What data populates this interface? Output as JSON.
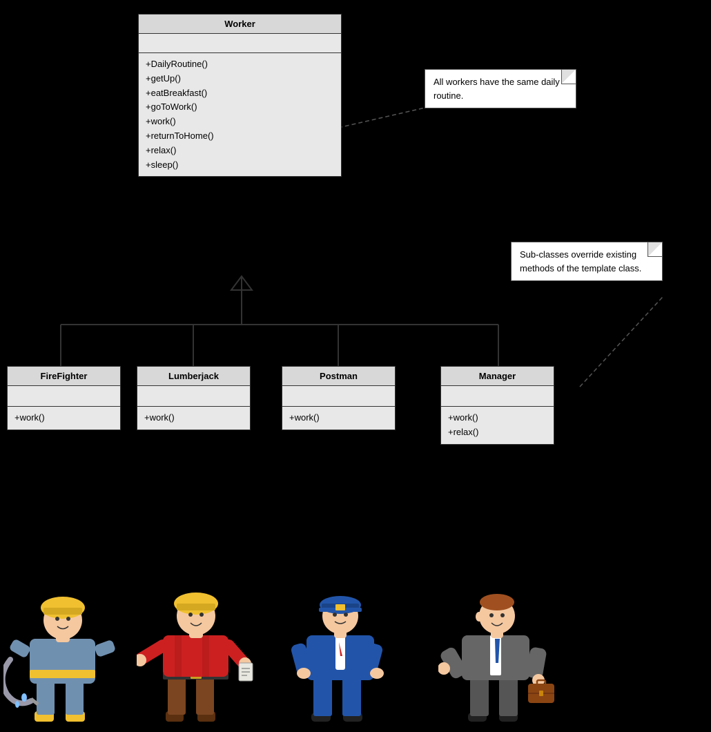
{
  "classes": {
    "worker": {
      "name": "Worker",
      "fields": [],
      "methods": [
        "+DailyRoutine()",
        "+getUp()",
        "+eatBreakfast()",
        "+goToWork()",
        "+work()",
        "+returnToHome()",
        "+relax()",
        "+sleep()"
      ]
    },
    "firefighter": {
      "name": "FireFighter",
      "fields": [],
      "methods": [
        "+work()"
      ]
    },
    "lumberjack": {
      "name": "Lumberjack",
      "fields": [],
      "methods": [
        "+work()"
      ]
    },
    "postman": {
      "name": "Postman",
      "fields": [],
      "methods": [
        "+work()"
      ]
    },
    "manager": {
      "name": "Manager",
      "fields": [],
      "methods": [
        "+work()",
        "+relax()"
      ]
    }
  },
  "notes": {
    "note1": "All workers have the same daily routine.",
    "note2": "Sub-classes override existing methods of the template class."
  }
}
